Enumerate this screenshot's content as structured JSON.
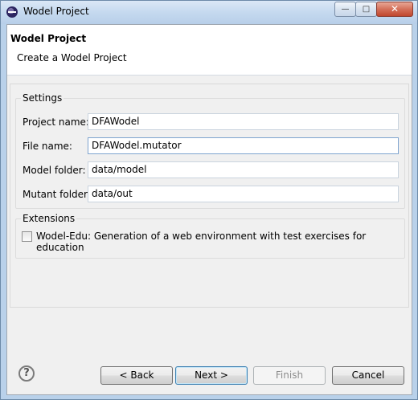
{
  "window": {
    "title": "Wodel Project",
    "controls": {
      "minimize": "—",
      "maximize": "□",
      "close": "✕"
    }
  },
  "header": {
    "title": "Wodel Project",
    "subtitle": "Create a Wodel Project"
  },
  "settings": {
    "label": "Settings",
    "fields": [
      {
        "label": "Project name:",
        "value": "DFAWodel"
      },
      {
        "label": "File name:",
        "value": "DFAWodel.mutator"
      },
      {
        "label": "Model folder:",
        "value": "data/model"
      },
      {
        "label": "Mutant folder:",
        "value": "data/out"
      }
    ]
  },
  "extensions": {
    "label": "Extensions",
    "checkbox_label": "Wodel-Edu: Generation of a web environment with test exercises for education",
    "checked": false
  },
  "buttons": {
    "help": "?",
    "back": "< Back",
    "next": "Next >",
    "finish": "Finish",
    "cancel": "Cancel"
  }
}
